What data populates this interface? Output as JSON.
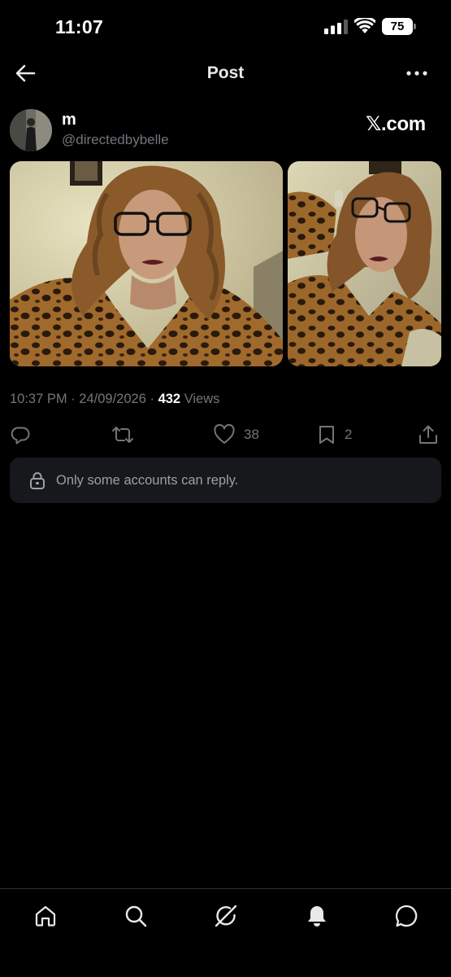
{
  "status_bar": {
    "time": "11:07",
    "battery_level": "75"
  },
  "header": {
    "title": "Post"
  },
  "post": {
    "author": {
      "name": "m",
      "handle": "@directedbybelle"
    },
    "watermark": "𝕏.com",
    "media": [
      {
        "description": "photo",
        "index": 1
      },
      {
        "description": "photo",
        "index": 2
      }
    ],
    "meta": {
      "time": "10:37 PM",
      "separator": " · ",
      "date": "24/09/2026",
      "views_count": "432",
      "views_label": "Views"
    },
    "actions": {
      "reply": {
        "icon": "reply-icon"
      },
      "repost": {
        "icon": "repost-icon"
      },
      "like": {
        "icon": "heart-icon",
        "count": "38"
      },
      "bookmark": {
        "icon": "bookmark-icon",
        "count": "2"
      },
      "share": {
        "icon": "share-icon"
      }
    },
    "reply_notice": "Only some accounts can reply."
  },
  "bottom_nav": {
    "items": [
      "home-icon",
      "search-icon",
      "grok-icon",
      "notifications-icon",
      "messages-icon"
    ]
  },
  "colors": {
    "background": "#000000",
    "primary_text": "#e7e9ea",
    "secondary_text": "#71767b",
    "notice_bg": "#16181c",
    "divider": "#2f3336"
  }
}
